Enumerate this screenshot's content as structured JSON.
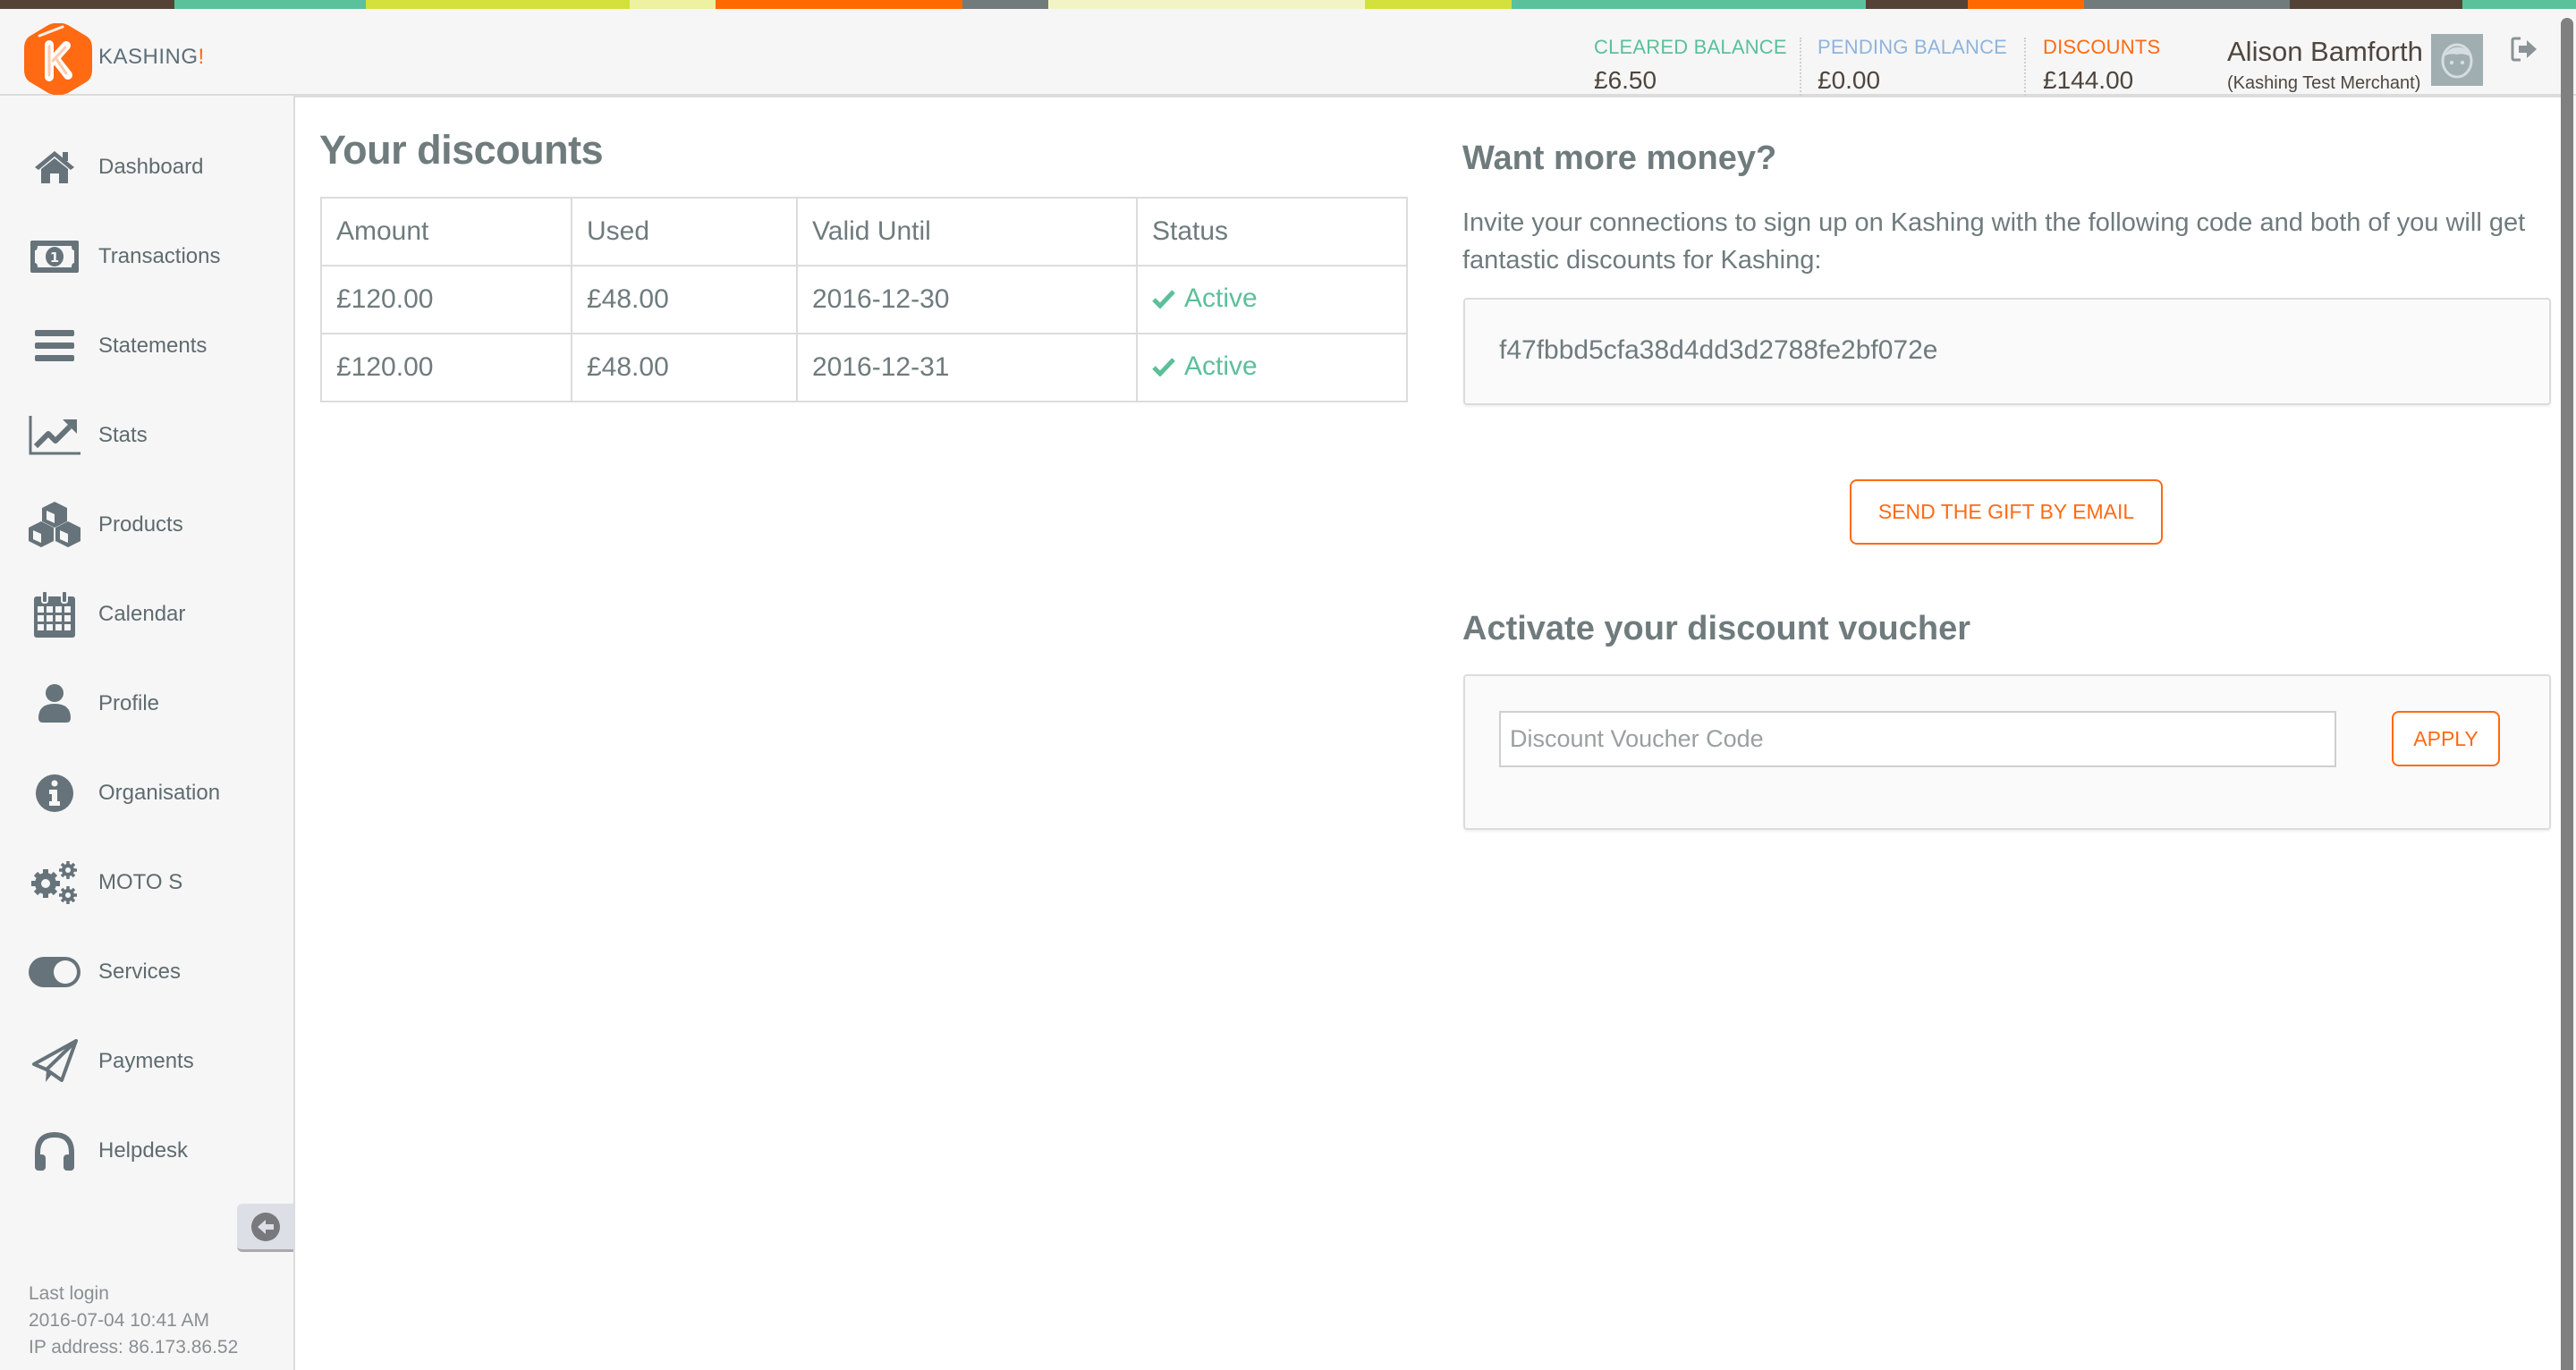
{
  "colors": {
    "accent_orange": "#ff6a13",
    "cleared_green": "#5cbf9a",
    "pending_blue": "#8fb4dc",
    "text_gray": "#6f7b7d",
    "icon_gray": "#5f6b6f",
    "strip": [
      "#544237",
      "#5bc19c",
      "#d4e03b",
      "#eef1a0",
      "#ff6a00",
      "#727b7b",
      "#f3f4c6",
      "#d4e03b",
      "#5bc19c",
      "#544237",
      "#ff6a00",
      "#727b7b",
      "#544237",
      "#5bc19c"
    ]
  },
  "brand": {
    "name": "KASHING",
    "exclaim": "!",
    "logo_icon": "kashing-k-hexagon-logo"
  },
  "header": {
    "stats": [
      {
        "label": "CLEARED BALANCE",
        "value": "£6.50"
      },
      {
        "label": "PENDING BALANCE",
        "value": "£0.00"
      },
      {
        "label": "DISCOUNTS",
        "value": "£144.00"
      }
    ],
    "user": {
      "name": "Alison Bamforth",
      "merchant": "(Kashing Test Merchant)",
      "avatar_icon": "user-avatar-icon"
    },
    "logout_icon": "sign-out-icon"
  },
  "sidebar": {
    "items": [
      {
        "label": "Dashboard",
        "icon": "home-icon"
      },
      {
        "label": "Transactions",
        "icon": "money-bill-icon"
      },
      {
        "label": "Statements",
        "icon": "bars-icon"
      },
      {
        "label": "Stats",
        "icon": "line-chart-icon"
      },
      {
        "label": "Products",
        "icon": "cubes-icon"
      },
      {
        "label": "Calendar",
        "icon": "calendar-icon"
      },
      {
        "label": "Profile",
        "icon": "user-icon"
      },
      {
        "label": "Organisation",
        "icon": "info-circle-icon"
      },
      {
        "label": "MOTO S",
        "icon": "gears-icon"
      },
      {
        "label": "Services",
        "icon": "toggle-on-icon"
      },
      {
        "label": "Payments",
        "icon": "paper-plane-icon"
      },
      {
        "label": "Helpdesk",
        "icon": "headphones-icon"
      }
    ],
    "collapse_icon": "arrow-circle-left-icon",
    "last_login_label": "Last login",
    "last_login_time": "2016-07-04 10:41 AM",
    "ip_address": "IP address: 86.173.86.52"
  },
  "discounts": {
    "title": "Your discounts",
    "columns": [
      "Amount",
      "Used",
      "Valid Until",
      "Status"
    ],
    "rows": [
      {
        "amount": "£120.00",
        "used": "£48.00",
        "valid_until": "2016-12-30",
        "status": "Active"
      },
      {
        "amount": "£120.00",
        "used": "£48.00",
        "valid_until": "2016-12-31",
        "status": "Active"
      }
    ]
  },
  "referral": {
    "title": "Want more money?",
    "description": "Invite your connections to sign up on Kashing with the following code and both of you will get fantastic discounts for Kashing:",
    "code": "f47fbbd5cfa38d4dd3d2788fe2bf072e",
    "send_button": "SEND THE GIFT BY EMAIL"
  },
  "voucher": {
    "title": "Activate your discount voucher",
    "input_value": "",
    "input_placeholder": "Discount Voucher Code",
    "apply_button": "APPLY"
  }
}
